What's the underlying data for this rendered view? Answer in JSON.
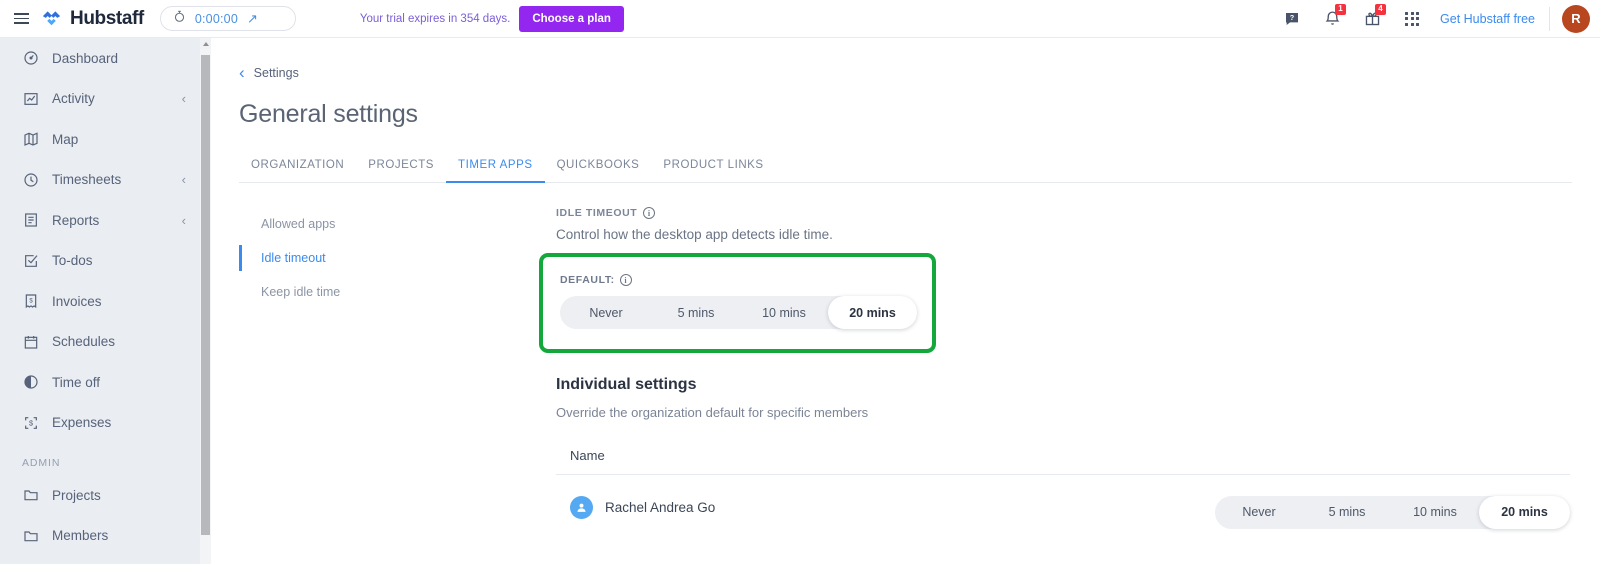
{
  "topbar": {
    "menu_icon": "hamburger-icon",
    "brand": "Hubstaff",
    "timer_value": "0:00:00",
    "timer_icon": "stopwatch-icon",
    "timer_expand_icon": "arrow-up-right-icon",
    "trial_text": "Your trial expires in 354 days.",
    "plan_button": "Choose a plan",
    "help_icon": "help-chat-icon",
    "notifications_icon": "bell-icon",
    "notifications_badge": "1",
    "gifts_icon": "gift-icon",
    "gifts_badge": "4",
    "apps_icon": "app-grid-icon",
    "get_free": "Get Hubstaff free",
    "avatar_initial": "R",
    "accent_purple": "#9327f0",
    "accent_blue": "#3b8bef",
    "badge_red": "#f5333f",
    "avatar_color": "#b8461f"
  },
  "sidebar": {
    "items": [
      {
        "label": "Dashboard",
        "icon": "dashboard-gauge-icon",
        "chevron": ""
      },
      {
        "label": "Activity",
        "icon": "activity-chart-icon",
        "chevron": "‹"
      },
      {
        "label": "Map",
        "icon": "map-icon",
        "chevron": ""
      },
      {
        "label": "Timesheets",
        "icon": "clock-icon",
        "chevron": "‹"
      },
      {
        "label": "Reports",
        "icon": "report-document-icon",
        "chevron": "‹"
      },
      {
        "label": "To-dos",
        "icon": "checkbox-icon",
        "chevron": ""
      },
      {
        "label": "Invoices",
        "icon": "invoice-icon",
        "chevron": ""
      },
      {
        "label": "Schedules",
        "icon": "calendar-icon",
        "chevron": ""
      },
      {
        "label": "Time off",
        "icon": "pie-clock-icon",
        "chevron": ""
      },
      {
        "label": "Expenses",
        "icon": "expense-dollar-icon",
        "chevron": ""
      }
    ],
    "section_label": "ADMIN",
    "admin_items": [
      {
        "label": "Projects",
        "icon": "folder-icon",
        "chevron": ""
      },
      {
        "label": "Members",
        "icon": "folder-icon",
        "chevron": ""
      }
    ]
  },
  "main": {
    "breadcrumb": "Settings",
    "page_title": "General settings",
    "tabs": [
      {
        "label": "ORGANIZATION",
        "active": false
      },
      {
        "label": "PROJECTS",
        "active": false
      },
      {
        "label": "TIMER APPS",
        "active": true
      },
      {
        "label": "QUICKBOOKS",
        "active": false
      },
      {
        "label": "PRODUCT LINKS",
        "active": false
      }
    ],
    "subnav": [
      {
        "label": "Allowed apps",
        "active": false
      },
      {
        "label": "Idle timeout",
        "active": true
      },
      {
        "label": "Keep idle time",
        "active": false
      }
    ],
    "idle": {
      "eyebrow": "IDLE TIMEOUT",
      "description": "Control how the desktop app detects idle time.",
      "default_label": "DEFAULT:",
      "options": [
        "Never",
        "5 mins",
        "10 mins",
        "20 mins"
      ],
      "selected": "20 mins",
      "highlight_color": "#14a83c"
    },
    "individual": {
      "title": "Individual settings",
      "subtitle": "Override the organization default for specific members",
      "column_name": "Name",
      "rows": [
        {
          "name": "Rachel Andrea Go",
          "avatar_icon": "user-avatar-icon",
          "options": [
            "Never",
            "5 mins",
            "10 mins",
            "20 mins"
          ],
          "selected": "20 mins"
        }
      ]
    }
  }
}
